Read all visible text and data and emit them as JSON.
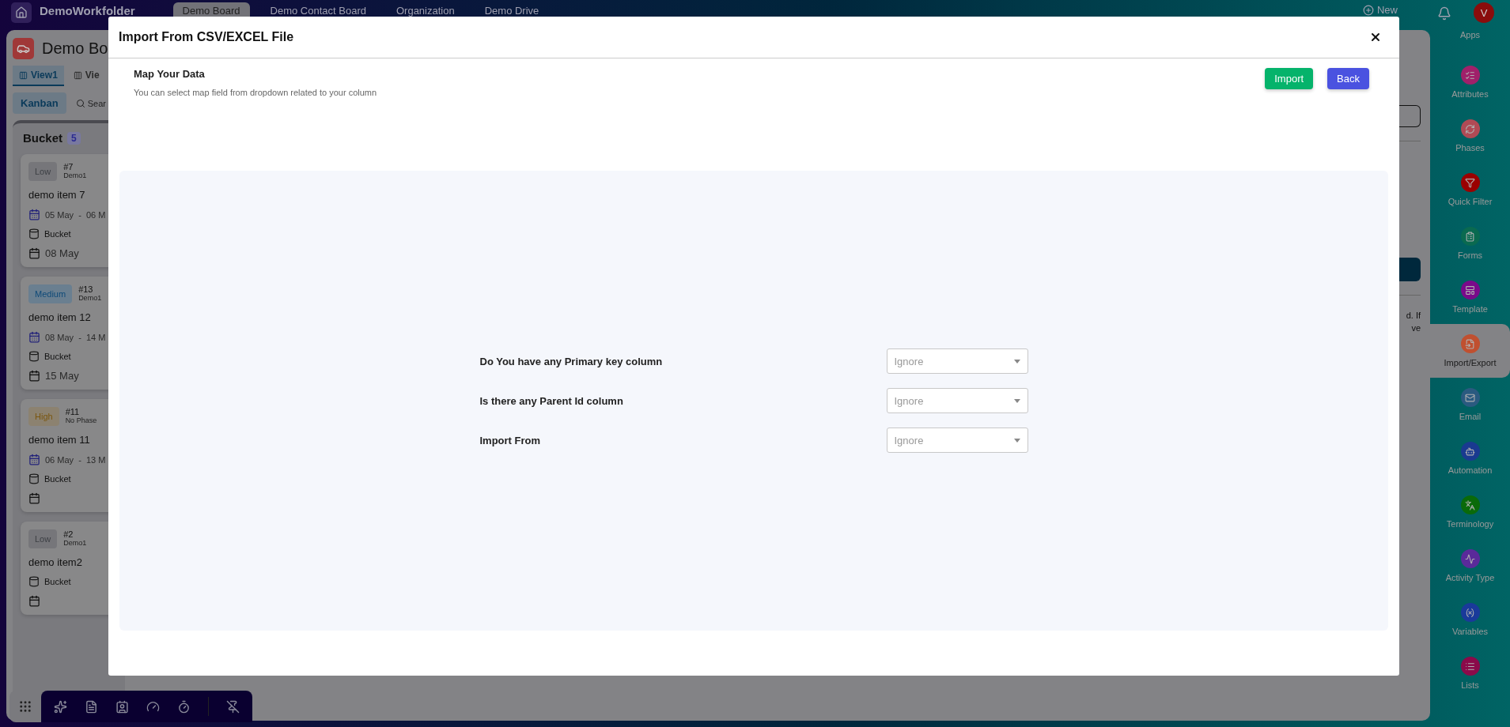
{
  "top_bar": {
    "brand": "DemoWorkfolder",
    "tabs": [
      {
        "label": "Demo Board",
        "selected": true
      },
      {
        "label": "Demo Contact Board",
        "selected": false
      },
      {
        "label": "Organization",
        "selected": false
      },
      {
        "label": "Demo Drive",
        "selected": false
      }
    ],
    "new_button": "New",
    "avatar": "V"
  },
  "board": {
    "title": "Demo Bo",
    "views": [
      {
        "label": "View1",
        "selected": true
      },
      {
        "label": "Vie",
        "selected": false
      }
    ],
    "layout_button": "Kanban",
    "search": "Sear",
    "column": {
      "title": "Bucket",
      "count": "5",
      "cards": [
        {
          "kind": "low",
          "priority": "Low",
          "number": "#7",
          "phase": "Demo1",
          "title": "demo item 7",
          "date_range": "05 May  -  06 M",
          "bucket": "Bucket",
          "due": "08 May"
        },
        {
          "kind": "medium",
          "priority": "Medium",
          "number": "#13",
          "phase": "Demo1",
          "title": "demo item 12",
          "date_range": "08 May  -  14 M",
          "bucket": "Bucket",
          "due": "15 May"
        },
        {
          "kind": "high",
          "priority": "High",
          "number": "#11",
          "phase": "No Phase",
          "title": "demo item 11",
          "date_range": "06 May  -  13 M",
          "bucket": "Bucket"
        },
        {
          "kind": "low",
          "priority": "Low",
          "number": "#2",
          "phase": "Demo1",
          "title": "demo item2",
          "bucket": "Bucket"
        }
      ]
    },
    "side_panel_text": [
      "d. If",
      "ve"
    ]
  },
  "sidebar": {
    "items": [
      {
        "label": "Apps",
        "selected": false
      },
      {
        "label": "Attributes",
        "selected": false,
        "color": "#a0206a"
      },
      {
        "label": "Phases",
        "selected": false,
        "color": "#b04a55"
      },
      {
        "label": "Quick Filter",
        "selected": false,
        "color": "#9a0000"
      },
      {
        "label": "Forms",
        "selected": false,
        "color": "#0a6a50"
      },
      {
        "label": "Template",
        "selected": false,
        "color": "#7a0a8a"
      },
      {
        "label": "Import/Export",
        "selected": true,
        "color": "#c05030"
      },
      {
        "label": "Email",
        "selected": false,
        "color": "#2a5a80"
      },
      {
        "label": "Automation",
        "selected": false,
        "color": "#1a3a90"
      },
      {
        "label": "Terminology",
        "selected": false,
        "color": "#0a6a0a"
      },
      {
        "label": "Activity Type",
        "selected": false,
        "color": "#5a2a9a"
      },
      {
        "label": "Variables",
        "selected": false,
        "color": "#1a3a9a"
      },
      {
        "label": "Lists",
        "selected": false,
        "color": "#8a0a4a"
      }
    ]
  },
  "modal": {
    "title": "Import From CSV/EXCEL File",
    "heading": "Map Your Data",
    "subtitle": "You can select map field from dropdown related to your column",
    "buttons": [
      {
        "kind": "primary",
        "label": "Import"
      },
      {
        "kind": "secondary",
        "label": "Back"
      }
    ],
    "fields": [
      {
        "label": "Do You have any Primary key column",
        "placeholder": "Ignore"
      },
      {
        "label": "Is there any Parent Id column",
        "placeholder": "Ignore"
      },
      {
        "label": "Import From",
        "placeholder": "Ignore"
      }
    ]
  }
}
